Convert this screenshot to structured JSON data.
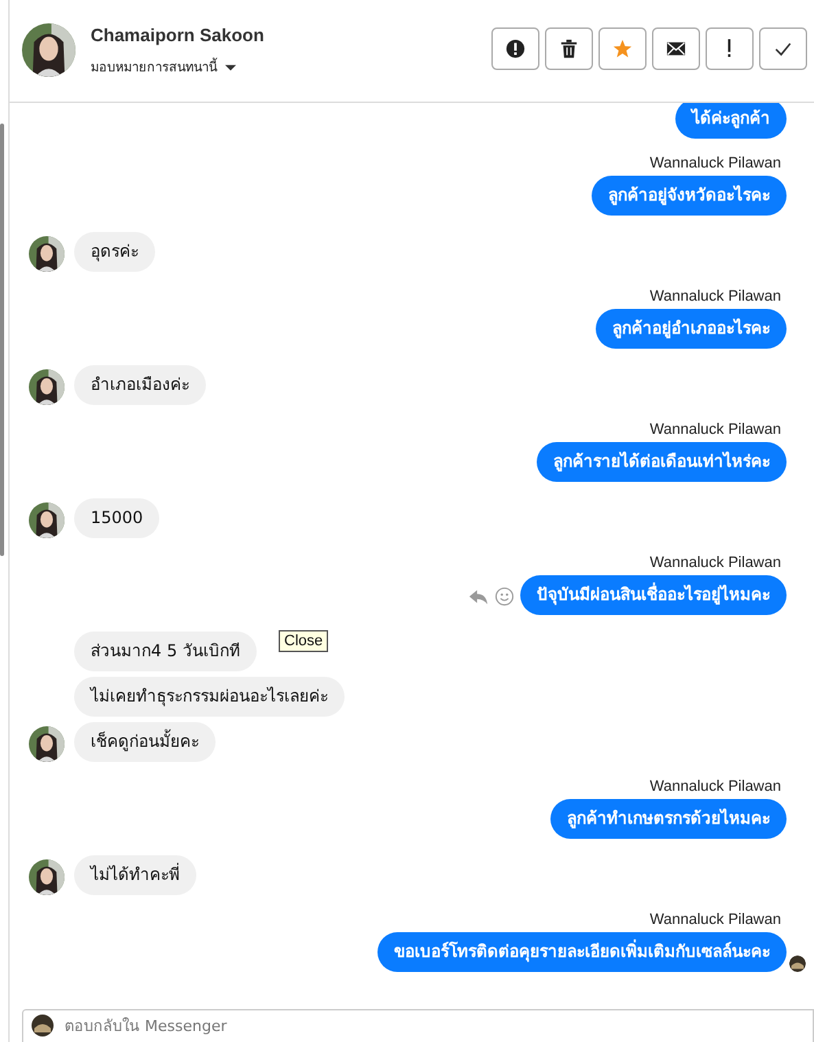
{
  "header": {
    "name": "Chamaiporn Sakoon",
    "assign_label": "มอบหมายการสนทนานี้",
    "actions": [
      {
        "kind": "alert"
      },
      {
        "kind": "trash"
      },
      {
        "kind": "star"
      },
      {
        "kind": "mail"
      },
      {
        "kind": "bang"
      },
      {
        "kind": "check"
      }
    ]
  },
  "messages": [
    {
      "kind": "outgoing",
      "texts": [
        "ได้ค่ะลูกค้า"
      ]
    },
    {
      "kind": "outgoing",
      "sender": "Wannaluck Pilawan",
      "texts": [
        "ลูกค้าอยู่จังหวัดอะไรคะ"
      ]
    },
    {
      "kind": "incoming",
      "texts": [
        "อุดรค่ะ"
      ]
    },
    {
      "kind": "outgoing",
      "sender": "Wannaluck Pilawan",
      "texts": [
        "ลูกค้าอยู่อำเภออะไรคะ"
      ]
    },
    {
      "kind": "incoming",
      "texts": [
        "อำเภอเมืองค่ะ"
      ]
    },
    {
      "kind": "outgoing",
      "sender": "Wannaluck Pilawan",
      "texts": [
        "ลูกค้ารายได้ต่อเดือนเท่าไหร่คะ"
      ]
    },
    {
      "kind": "incoming",
      "texts": [
        "15000"
      ]
    },
    {
      "kind": "outgoing",
      "sender": "Wannaluck Pilawan",
      "texts": [
        "ปัจุบันมีผ่อนสินเชื่ออะไรอยู่ไหมคะ"
      ],
      "hover_actions": true
    },
    {
      "kind": "incoming",
      "texts": [
        "ส่วนมาก4 5 วันเบิกที",
        "ไม่เคยทำธุระกรรมผ่อนอะไรเลยค่ะ",
        "เช็คดูก่อนมั้ยคะ"
      ]
    },
    {
      "kind": "outgoing",
      "sender": "Wannaluck Pilawan",
      "texts": [
        "ลูกค้าทำเกษตรกรด้วยไหมคะ"
      ]
    },
    {
      "kind": "incoming",
      "texts": [
        "ไม่ได้ทำคะพี่"
      ]
    },
    {
      "kind": "outgoing",
      "sender": "Wannaluck Pilawan",
      "texts": [
        "ขอเบอร์โทรติดต่อคุยรายละเอียดเพิ่มเติมกับเซลล์นะคะ"
      ],
      "seen": true
    }
  ],
  "tooltip": "Close",
  "composer": {
    "placeholder": "ตอบกลับใน Messenger"
  }
}
